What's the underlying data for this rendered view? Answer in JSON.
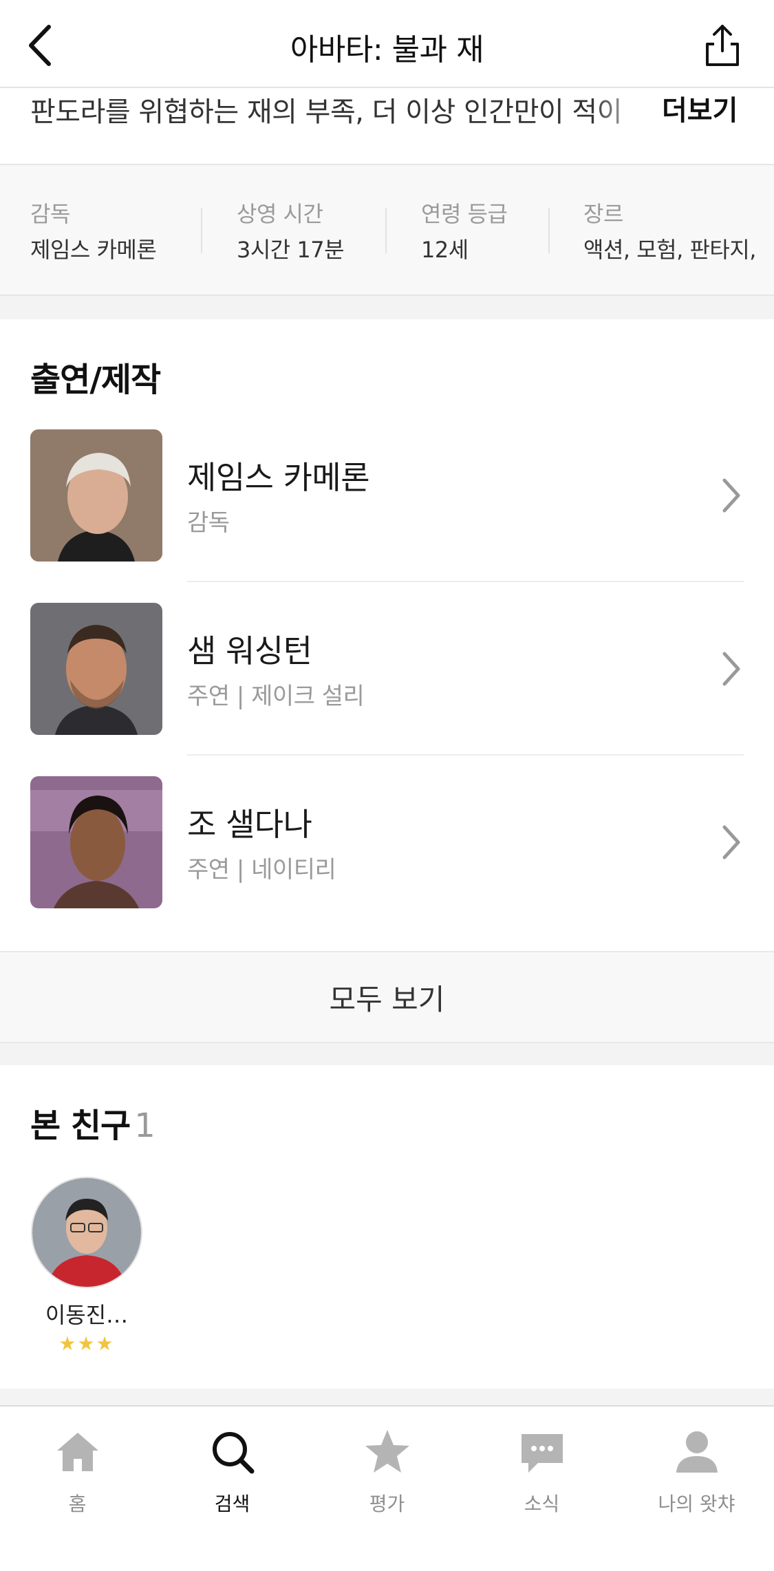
{
  "header": {
    "title": "아바타: 불과 재"
  },
  "synopsis": {
    "text": "판도라를 위협하는 재의 부족, 더 이상 인간만이 적이",
    "more_label": "더보기"
  },
  "info": [
    {
      "label": "감독",
      "value": "제임스 카메론"
    },
    {
      "label": "상영 시간",
      "value": "3시간 17분"
    },
    {
      "label": "연령 등급",
      "value": "12세"
    },
    {
      "label": "장르",
      "value": "액션, 모험, 판타지,"
    }
  ],
  "cast_section": {
    "title": "출연/제작",
    "members": [
      {
        "name": "제임스 카메론",
        "role": "감독"
      },
      {
        "name": "샘 워싱턴",
        "role": "주연 | 제이크 설리"
      },
      {
        "name": "조 샐다나",
        "role": "주연 | 네이티리"
      }
    ],
    "see_all_label": "모두 보기"
  },
  "friends_section": {
    "title": "본 친구",
    "count": "1",
    "friends": [
      {
        "name": "이동진…",
        "stars": "★★★"
      }
    ]
  },
  "tabbar": {
    "tabs": [
      {
        "label": "홈",
        "icon": "home-icon"
      },
      {
        "label": "검색",
        "icon": "search-icon"
      },
      {
        "label": "평가",
        "icon": "star-icon"
      },
      {
        "label": "소식",
        "icon": "chat-bubble-icon"
      },
      {
        "label": "나의 왓챠",
        "icon": "person-icon"
      }
    ],
    "active": "검색"
  },
  "colors": {
    "star_rating": "#f2c43d",
    "tab_inactive": "#b4b4b4",
    "tab_active": "#111111"
  }
}
